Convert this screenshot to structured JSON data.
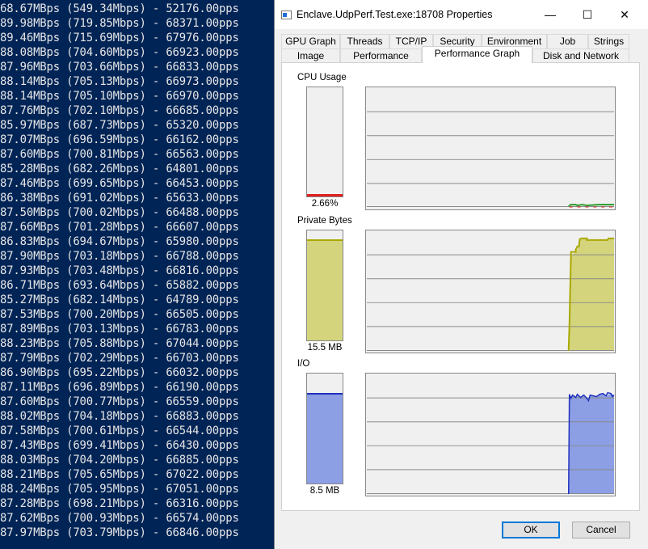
{
  "terminal": {
    "lines": [
      "68.67MBps (549.34Mbps) - 52176.00pps",
      "89.98MBps (719.85Mbps) - 68371.00pps",
      "89.46MBps (715.69Mbps) - 67976.00pps",
      "88.08MBps (704.60Mbps) - 66923.00pps",
      "87.96MBps (703.66Mbps) - 66833.00pps",
      "88.14MBps (705.13Mbps) - 66973.00pps",
      "88.14MBps (705.10Mbps) - 66970.00pps",
      "87.76MBps (702.10Mbps) - 66685.00pps",
      "85.97MBps (687.73Mbps) - 65320.00pps",
      "87.07MBps (696.59Mbps) - 66162.00pps",
      "87.60MBps (700.81Mbps) - 66563.00pps",
      "85.28MBps (682.26Mbps) - 64801.00pps",
      "87.46MBps (699.65Mbps) - 66453.00pps",
      "86.38MBps (691.02Mbps) - 65633.00pps",
      "87.50MBps (700.02Mbps) - 66488.00pps",
      "87.66MBps (701.28Mbps) - 66607.00pps",
      "86.83MBps (694.67Mbps) - 65980.00pps",
      "87.90MBps (703.18Mbps) - 66788.00pps",
      "87.93MBps (703.48Mbps) - 66816.00pps",
      "86.71MBps (693.64Mbps) - 65882.00pps",
      "85.27MBps (682.14Mbps) - 64789.00pps",
      "87.53MBps (700.20Mbps) - 66505.00pps",
      "87.89MBps (703.13Mbps) - 66783.00pps",
      "88.23MBps (705.88Mbps) - 67044.00pps",
      "87.79MBps (702.29Mbps) - 66703.00pps",
      "86.90MBps (695.22Mbps) - 66032.00pps",
      "87.11MBps (696.89Mbps) - 66190.00pps",
      "87.60MBps (700.77Mbps) - 66559.00pps",
      "88.02MBps (704.18Mbps) - 66883.00pps",
      "87.58MBps (700.61Mbps) - 66544.00pps",
      "87.43MBps (699.41Mbps) - 66430.00pps",
      "88.03MBps (704.20Mbps) - 66885.00pps",
      "88.21MBps (705.65Mbps) - 67022.00pps",
      "88.24MBps (705.95Mbps) - 67051.00pps",
      "87.28MBps (698.21Mbps) - 66316.00pps",
      "87.62MBps (700.93Mbps) - 66574.00pps",
      "87.97MBps (703.79Mbps) - 66846.00pps"
    ]
  },
  "dialog": {
    "title": "Enclave.UdpPerf.Test.exe:18708 Properties",
    "controls": {
      "minimize": "—",
      "maximize": "☐",
      "close": "✕"
    },
    "tabs_row1": [
      "GPU Graph",
      "Threads",
      "TCP/IP",
      "Security",
      "Environment",
      "Job",
      "Strings"
    ],
    "tabs_row2": [
      "Image",
      "Performance",
      "Performance Graph",
      "Disk and Network"
    ],
    "active_tab": "Performance Graph",
    "cpu": {
      "label": "CPU Usage",
      "value": "2.66%",
      "level_percent": 2.66,
      "color": "#e02020"
    },
    "private_bytes": {
      "label": "Private Bytes",
      "value": "15.5 MB",
      "level_percent": 92,
      "color": "#d4d47c",
      "line_color": "#a8a800"
    },
    "io": {
      "label": "I/O",
      "value": "8.5  MB",
      "level_percent": 82,
      "color": "#8c9ee4",
      "line_color": "#2030c0"
    },
    "ok_label": "OK",
    "cancel_label": "Cancel"
  }
}
